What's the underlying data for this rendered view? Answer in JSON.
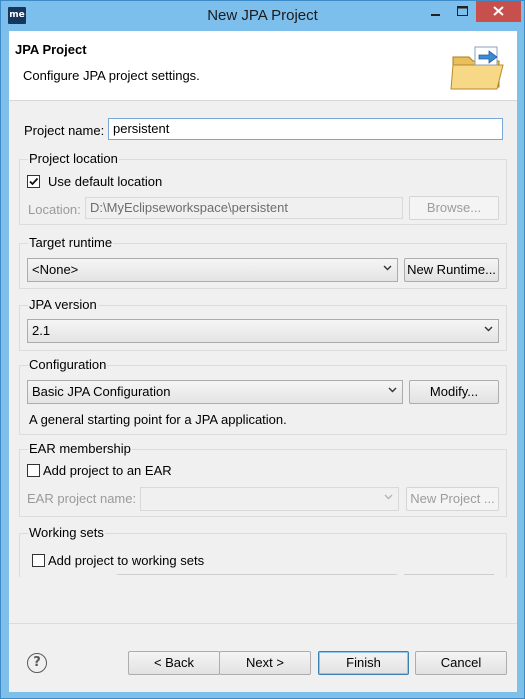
{
  "window": {
    "title": "New JPA Project",
    "app_icon_text": "me",
    "minimize_icon": "minimize-icon",
    "maximize_icon": "maximize-icon",
    "close_icon": "close-icon"
  },
  "banner": {
    "title": "JPA Project",
    "description": "Configure JPA project settings.",
    "icon": "folder-wizard-icon"
  },
  "project_name": {
    "label": "Project name:",
    "value": "persistent"
  },
  "project_location": {
    "title": "Project location",
    "use_default_label": "Use default location",
    "use_default_checked": true,
    "location_label": "Location:",
    "location_value": "D:\\MyEclipseworkspace\\persistent",
    "browse_label": "Browse..."
  },
  "target_runtime": {
    "title": "Target runtime",
    "selected": "<None>",
    "new_runtime_label": "New Runtime..."
  },
  "jpa_version": {
    "title": "JPA version",
    "selected": "2.1"
  },
  "configuration": {
    "title": "Configuration",
    "selected": "Basic JPA Configuration",
    "modify_label": "Modify...",
    "description": "A general starting point for a JPA application."
  },
  "ear_membership": {
    "title": "EAR membership",
    "add_label": "Add project to an EAR",
    "add_checked": false,
    "ear_project_label": "EAR project name:",
    "ear_project_value": "",
    "new_project_label": "New Project ..."
  },
  "working_sets": {
    "title": "Working sets",
    "add_label": "Add project to working sets",
    "add_checked": false
  },
  "footer": {
    "help_icon": "help-icon",
    "help_glyph": "?",
    "back_label": "< Back",
    "next_label": "Next >",
    "finish_label": "Finish",
    "cancel_label": "Cancel"
  },
  "colors": {
    "title_bar": "#7dbfec",
    "close_button": "#c74f4c",
    "dialog_bg": "#f0f0f0",
    "focus_border": "#7aa7d9"
  }
}
